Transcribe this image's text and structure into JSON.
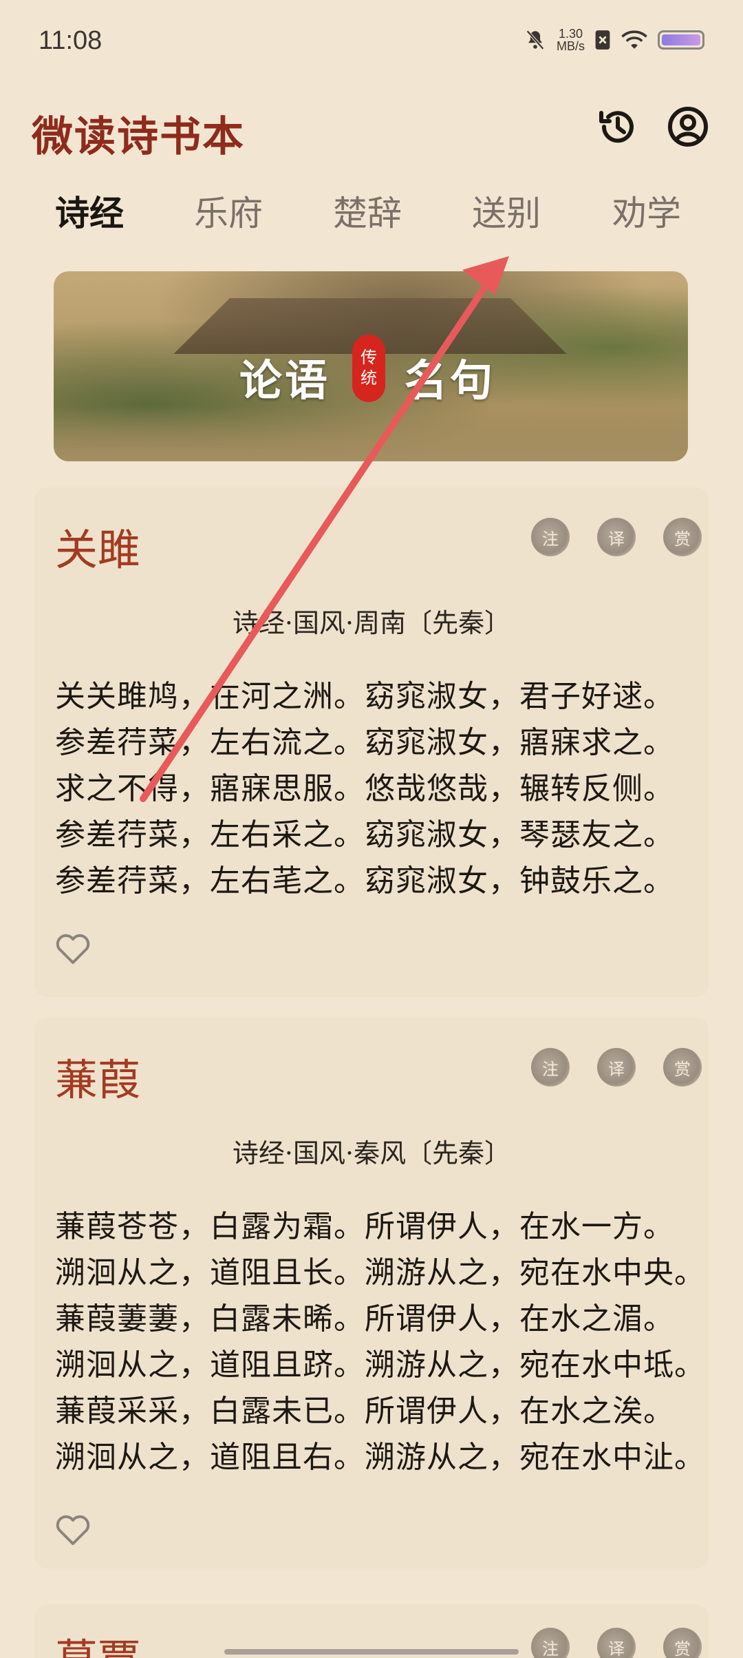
{
  "status": {
    "time": "11:08",
    "net_speed_value": "1.30",
    "net_speed_unit": "MB/s"
  },
  "header": {
    "title": "微读诗书本",
    "icons": [
      "history-icon",
      "account-icon"
    ]
  },
  "tabs": [
    {
      "label": "诗经",
      "active": true
    },
    {
      "label": "乐府",
      "active": false
    },
    {
      "label": "楚辞",
      "active": false
    },
    {
      "label": "送别",
      "active": false
    },
    {
      "label": "劝学",
      "active": false
    }
  ],
  "banner": {
    "left_text": "论语",
    "seal_text_1": "传",
    "seal_text_2": "统",
    "right_text": "名句"
  },
  "actions": {
    "annotate": "注",
    "translate": "译",
    "appreciate": "赏"
  },
  "poems": [
    {
      "title": "关雎",
      "source": "诗经·国风·周南〔先秦〕",
      "lines": [
        "关关雎鸠，在河之洲。窈窕淑女，君子好逑。",
        "参差荇菜，左右流之。窈窕淑女，寤寐求之。",
        "求之不得，寤寐思服。悠哉悠哉，辗转反侧。",
        "参差荇菜，左右采之。窈窕淑女，琴瑟友之。",
        "参差荇菜，左右芼之。窈窕淑女，钟鼓乐之。"
      ]
    },
    {
      "title": "蒹葭",
      "source": "诗经·国风·秦风〔先秦〕",
      "lines": [
        "蒹葭苍苍，白露为霜。所谓伊人，在水一方。",
        "溯洄从之，道阻且长。溯游从之，宛在水中央。",
        "蒹葭萋萋，白露未晞。所谓伊人，在水之湄。",
        "溯洄从之，道阻且跻。溯游从之，宛在水中坻。",
        "蒹葭采采，白露未已。所谓伊人，在水之涘。",
        "溯洄从之，道阻且右。溯游从之，宛在水中沚。"
      ]
    },
    {
      "title": "葛覃"
    }
  ],
  "colors": {
    "background": "#f2e6d2",
    "title_red": "#8f2b1c",
    "poem_title": "#a33a22",
    "gesture_arrow": "#e85a5a"
  }
}
